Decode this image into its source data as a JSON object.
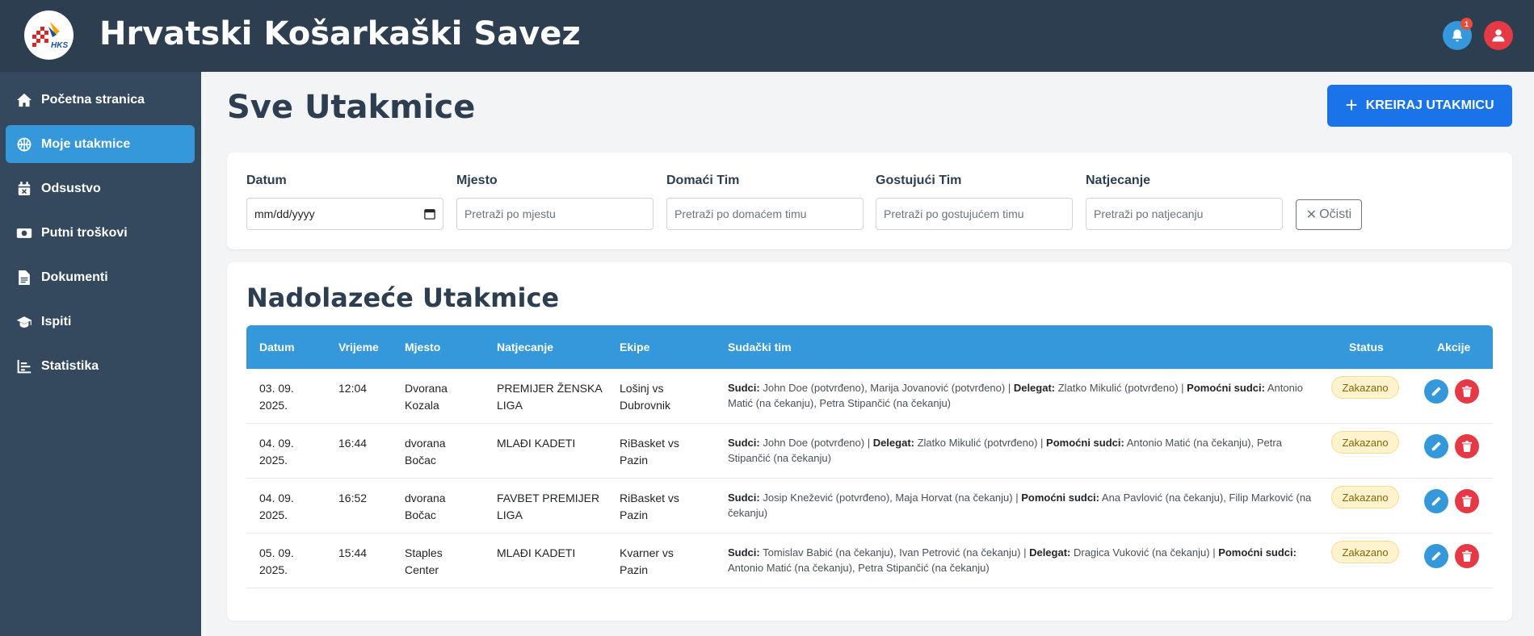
{
  "header": {
    "app_title": "Hrvatski Košarkaški Savez",
    "logo_text": "HKS",
    "notification_count": "1"
  },
  "sidebar": {
    "items": [
      {
        "label": "Početna stranica",
        "icon": "home-icon"
      },
      {
        "label": "Moje utakmice",
        "icon": "basketball-icon",
        "active": true
      },
      {
        "label": "Odsustvo",
        "icon": "calendar-x-icon"
      },
      {
        "label": "Putni troškovi",
        "icon": "money-icon"
      },
      {
        "label": "Dokumenti",
        "icon": "document-icon"
      },
      {
        "label": "Ispiti",
        "icon": "graduation-cap-icon"
      },
      {
        "label": "Statistika",
        "icon": "chart-icon"
      }
    ]
  },
  "page": {
    "title": "Sve Utakmice",
    "create_button": "KREIRAJ UTAKMICU"
  },
  "filters": {
    "date": {
      "label": "Datum",
      "value": "mm/dd/yyyy"
    },
    "place": {
      "label": "Mjesto",
      "placeholder": "Pretraži po mjestu"
    },
    "home": {
      "label": "Domaći Tim",
      "placeholder": "Pretraži po domaćem timu"
    },
    "away": {
      "label": "Gostujući Tim",
      "placeholder": "Pretraži po gostujućem timu"
    },
    "competition": {
      "label": "Natjecanje",
      "placeholder": "Pretraži po natjecanju"
    },
    "clear_button": "Očisti"
  },
  "matches": {
    "title": "Nadolazeće Utakmice",
    "columns": [
      "Datum",
      "Vrijeme",
      "Mjesto",
      "Natjecanje",
      "Ekipe",
      "Sudački tim",
      "Status",
      "Akcije"
    ],
    "rows": [
      {
        "date_l1": "03. 09.",
        "date_l2": "2025.",
        "time": "12:04",
        "place_l1": "Dvorana",
        "place_l2": "Kozala",
        "comp_l1": "PREMIJER ŽENSKA",
        "comp_l2": "LIGA",
        "teams_l1": "Lošinj vs",
        "teams_l2": "Dubrovnik",
        "refs_html": "<b>Sudci:</b> John Doe (potvrđeno), Marija Jovanović (potvrđeno) | <b>Delegat:</b> Zlatko Mikulić (potvrđeno) | <b>Pomoćni sudci:</b> Antonio Matić (na čekanju), Petra Stipančić (na čekanju)",
        "status": "Zakazano"
      },
      {
        "date_l1": "04. 09.",
        "date_l2": "2025.",
        "time": "16:44",
        "place_l1": "dvorana",
        "place_l2": "Bočac",
        "comp_l1": "MLAĐI KADETI",
        "comp_l2": "",
        "teams_l1": "RiBasket vs",
        "teams_l2": "Pazin",
        "refs_html": "<b>Sudci:</b> John Doe (potvrđeno) | <b>Delegat:</b> Zlatko Mikulić (potvrđeno) | <b>Pomoćni sudci:</b> Antonio Matić (na čekanju), Petra Stipančić (na čekanju)",
        "status": "Zakazano"
      },
      {
        "date_l1": "04. 09.",
        "date_l2": "2025.",
        "time": "16:52",
        "place_l1": "dvorana",
        "place_l2": "Bočac",
        "comp_l1": "FAVBET PREMIJER",
        "comp_l2": "LIGA",
        "teams_l1": "RiBasket vs",
        "teams_l2": "Pazin",
        "refs_html": "<b>Sudci:</b> Josip Knežević (potvrđeno), Maja Horvat (na čekanju) | <b>Pomoćni sudci:</b> Ana Pavlović (na čekanju), Filip Marković (na čekanju)",
        "status": "Zakazano"
      },
      {
        "date_l1": "05. 09.",
        "date_l2": "2025.",
        "time": "15:44",
        "place_l1": "Staples",
        "place_l2": "Center",
        "comp_l1": "MLAĐI KADETI",
        "comp_l2": "",
        "teams_l1": "Kvarner vs",
        "teams_l2": "Pazin",
        "refs_html": "<b>Sudci:</b> Tomislav Babić (na čekanju), Ivan Petrović (na čekanju) | <b>Delegat:</b> Dragica Vuković (na čekanju) | <b>Pomoćni sudci:</b> Antonio Matić (na čekanju), Petra Stipančić (na čekanju)",
        "status": "Zakazano"
      }
    ]
  },
  "colors": {
    "topbar": "#2c3e50",
    "sidebar": "#34495e",
    "accent": "#3498db",
    "primary_button": "#1a73e8",
    "danger": "#e63946",
    "status_bg": "#fff3cd"
  }
}
